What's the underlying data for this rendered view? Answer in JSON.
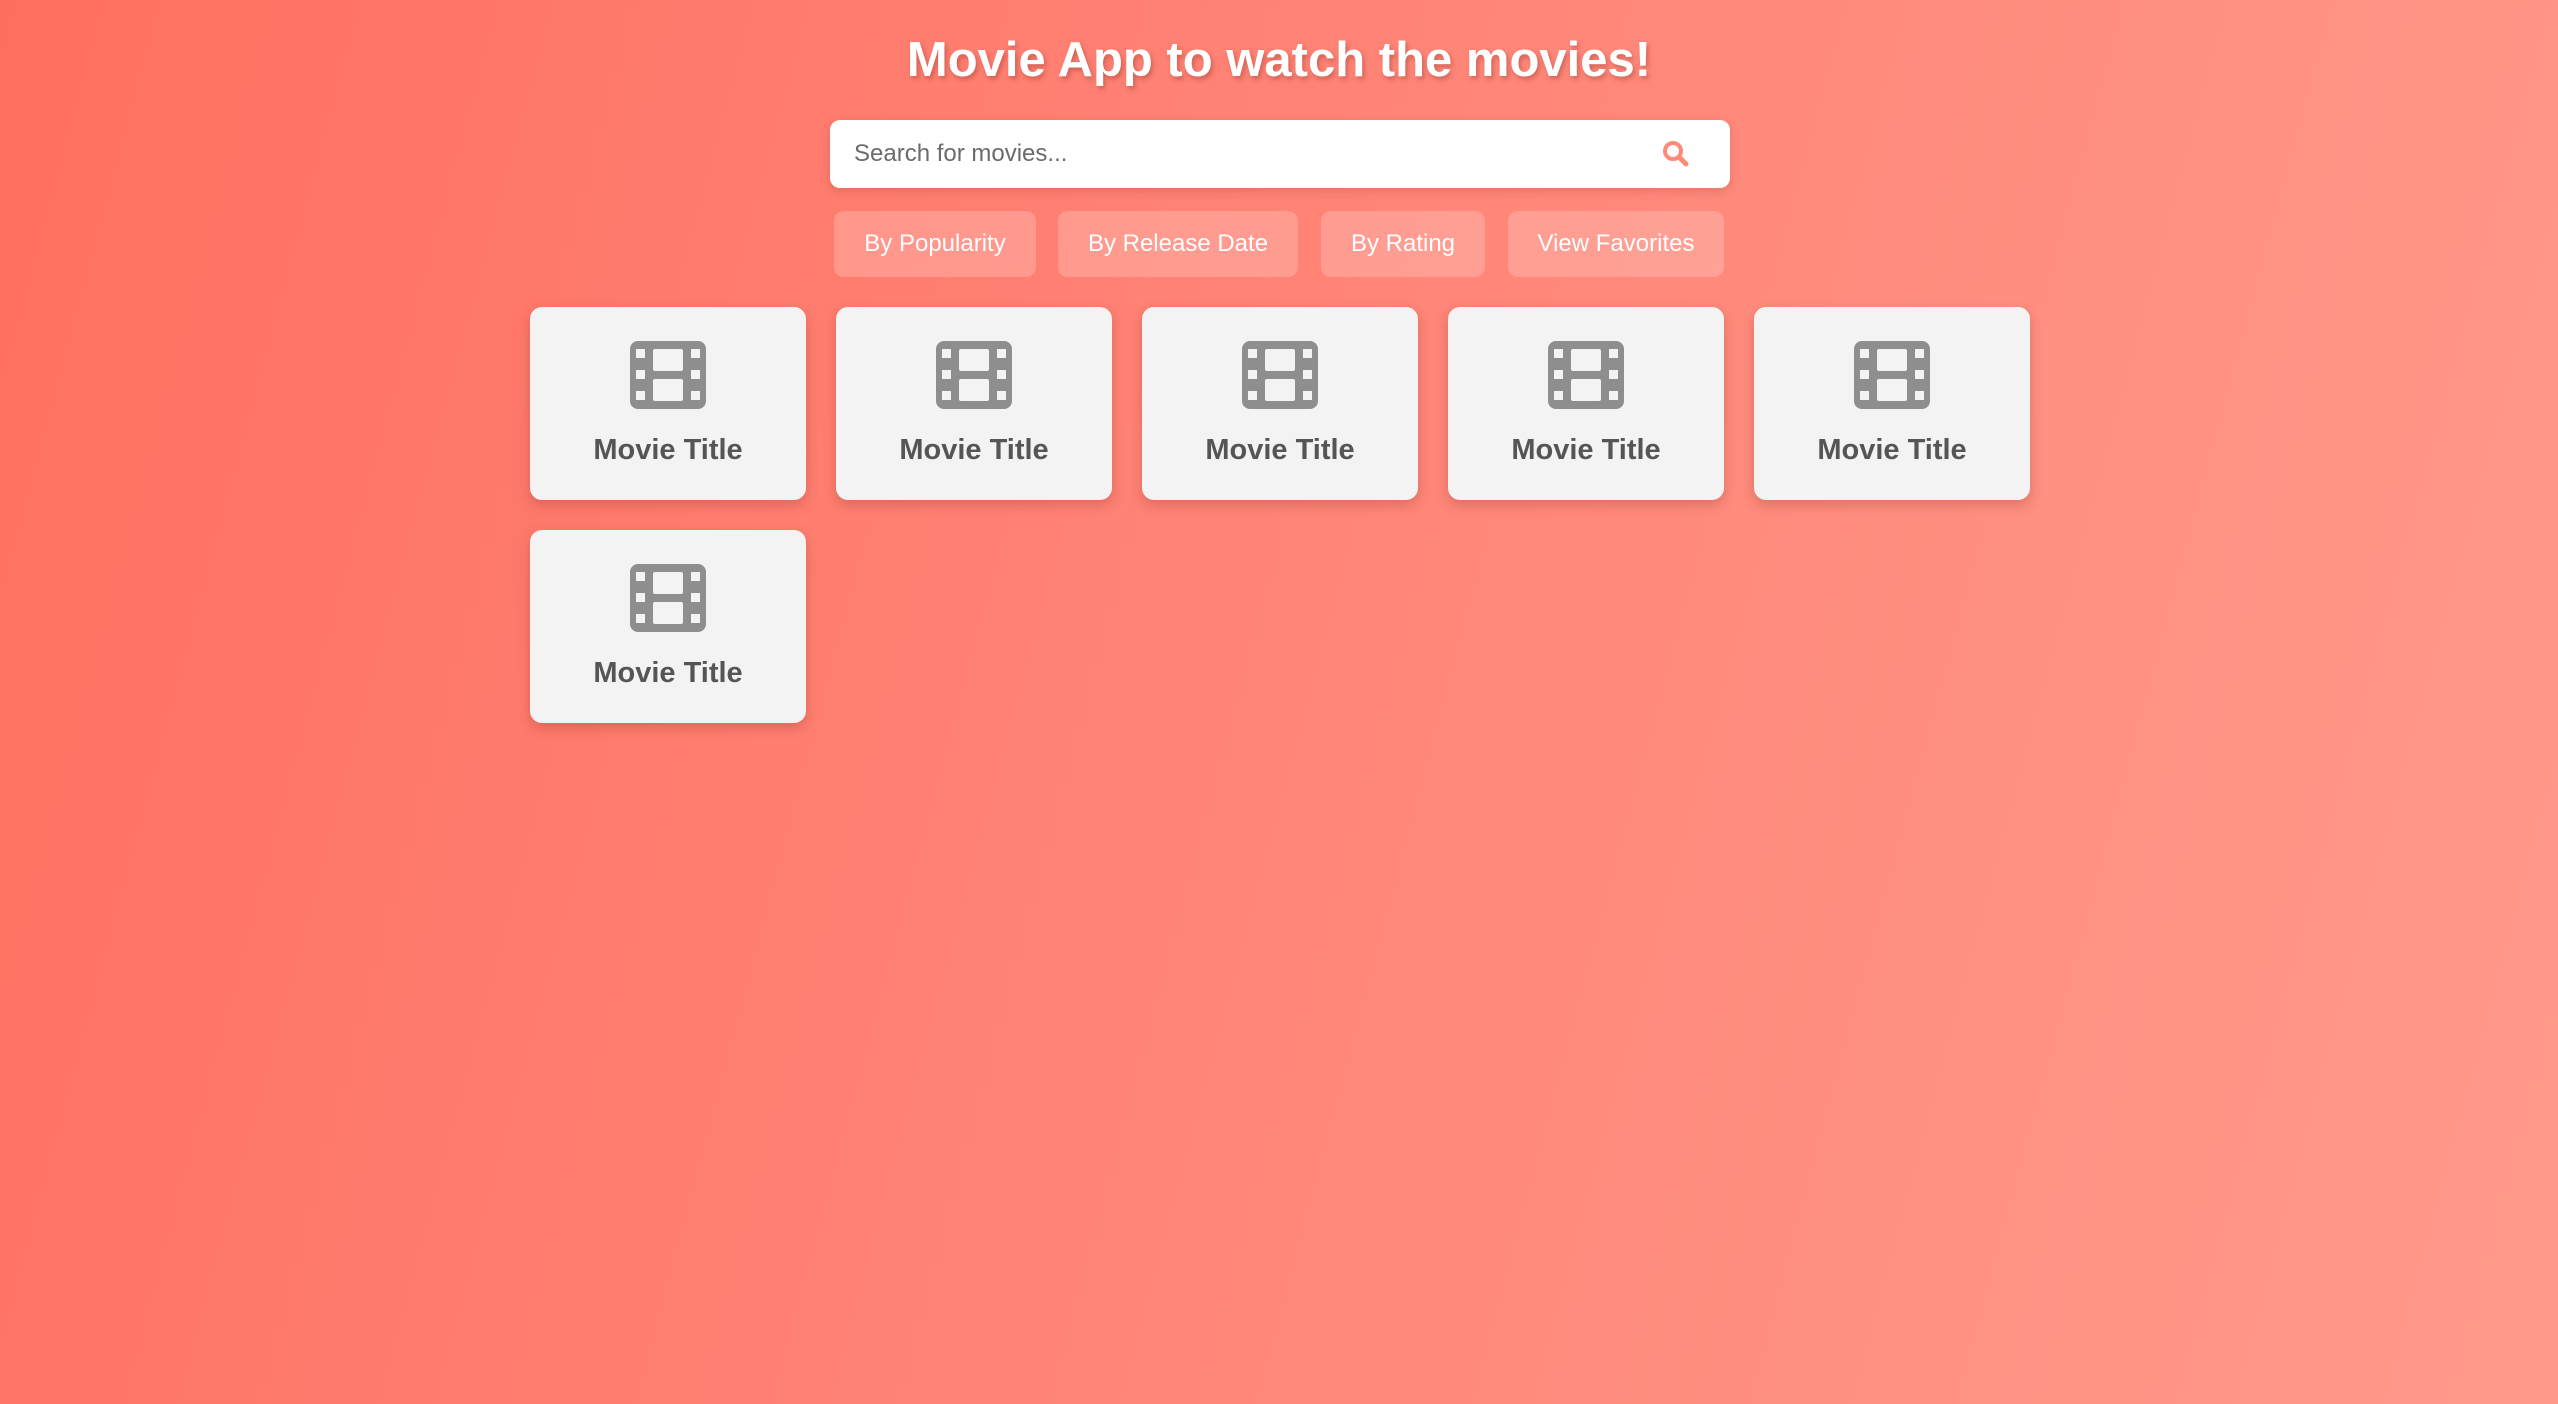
{
  "header": {
    "title": "Movie App to watch the movies!"
  },
  "search": {
    "placeholder": "Search for movies...",
    "value": "",
    "icon": "search-icon"
  },
  "filters": [
    {
      "label": "By Popularity"
    },
    {
      "label": "By Release Date"
    },
    {
      "label": "By Rating"
    },
    {
      "label": "View Favorites"
    }
  ],
  "movies": [
    {
      "title": "Movie Title",
      "icon": "film-icon"
    },
    {
      "title": "Movie Title",
      "icon": "film-icon"
    },
    {
      "title": "Movie Title",
      "icon": "film-icon"
    },
    {
      "title": "Movie Title",
      "icon": "film-icon"
    },
    {
      "title": "Movie Title",
      "icon": "film-icon"
    },
    {
      "title": "Movie Title",
      "icon": "film-icon"
    }
  ],
  "colors": {
    "background_start": "#ff6f61",
    "background_end": "#ff9a8b",
    "accent": "#ff8a7a",
    "card_background": "#f3f3f3",
    "card_text": "#555555",
    "icon_gray": "#8e8e8e"
  }
}
